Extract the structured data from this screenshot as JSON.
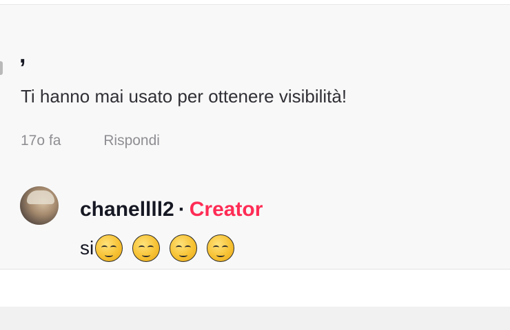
{
  "comment": {
    "author_fragment": ",",
    "text": "Ti hanno mai usato per ottenere visibilità!",
    "time": "17o fa",
    "reply_label": "Rispondi"
  },
  "reply": {
    "username": "chanellll2",
    "separator": "·",
    "badge": "Creator",
    "text": "si",
    "emojis": [
      "pensive-face-emoji",
      "pensive-face-emoji",
      "pensive-face-emoji",
      "pensive-face-emoji"
    ]
  },
  "colors": {
    "accent": "#fe2c55",
    "text_primary": "#161823",
    "text_secondary": "#8e8e93",
    "card_background": "#f8f8f8"
  }
}
